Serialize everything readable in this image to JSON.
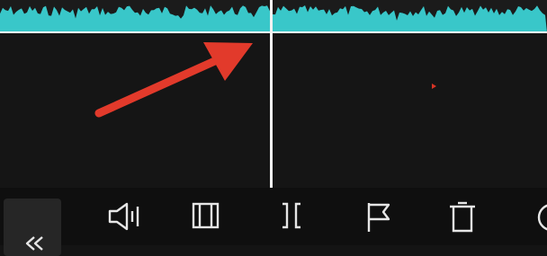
{
  "timeline": {
    "waveform_color": "#39c7c9",
    "playhead_color": "#f2f2f2",
    "annotation_color": "#e23a2b"
  },
  "toolbar": {
    "items": [
      {
        "icon": "chevrons-left-icon"
      },
      {
        "icon": "volume-icon"
      },
      {
        "icon": "split-panel-icon"
      },
      {
        "icon": "trim-bracket-icon"
      },
      {
        "icon": "flag-icon"
      },
      {
        "icon": "trash-icon"
      },
      {
        "icon": "more-circle-icon"
      }
    ]
  }
}
